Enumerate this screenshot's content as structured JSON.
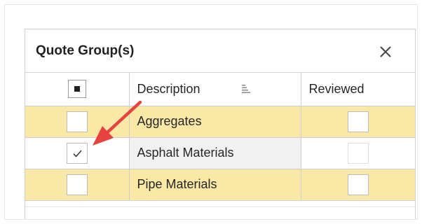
{
  "panel": {
    "title": "Quote Group(s)",
    "close_icon": "close-icon"
  },
  "grid": {
    "columns": {
      "select_all": {
        "label": "",
        "state": "indeterminate"
      },
      "description": {
        "label": "Description",
        "icon": "sort-icon"
      },
      "reviewed": {
        "label": "Reviewed"
      }
    },
    "rows": [
      {
        "description": "Aggregates",
        "selected": false,
        "reviewed": false,
        "highlighted": true
      },
      {
        "description": "Asphalt Materials",
        "selected": true,
        "reviewed": false,
        "highlighted": false
      },
      {
        "description": "Pipe Materials",
        "selected": false,
        "reviewed": false,
        "highlighted": true
      }
    ]
  },
  "annotation": {
    "type": "arrow",
    "color": "#e8423f",
    "points_to": "Asphalt Materials selected checkbox"
  },
  "colors": {
    "row_highlight": "#fae8a6",
    "grid_border": "#cfcfcf",
    "arrow": "#e8423f"
  }
}
